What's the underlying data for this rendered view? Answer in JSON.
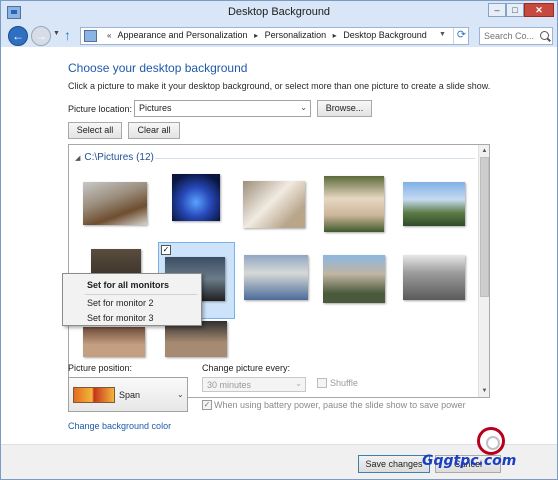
{
  "window": {
    "title": "Desktop Background",
    "min": "–",
    "max": "□",
    "close": "✕"
  },
  "nav": {
    "back": "←",
    "forward": "→",
    "up": "↑",
    "breadcrumbs": [
      "Appearance and Personalization",
      "Personalization",
      "Desktop Background"
    ],
    "search_placeholder": "Search Co..."
  },
  "main": {
    "heading": "Choose your desktop background",
    "instructions": "Click a picture to make it your desktop background, or select more than one picture to create a slide show.",
    "location_label": "Picture location:",
    "location_value": "Pictures",
    "browse_label": "Browse...",
    "select_all_label": "Select all",
    "clear_all_label": "Clear all",
    "group_label": "C:\\Pictures (12)",
    "selected_mark": "✓"
  },
  "context_menu": {
    "items": [
      "Set for all monitors",
      "Set for monitor 2",
      "Set for monitor 3"
    ]
  },
  "options": {
    "position_label": "Picture position:",
    "position_value": "Span",
    "interval_label": "Change picture every:",
    "interval_value": "30 minutes",
    "shuffle_label": "Shuffle",
    "battery_label": "When using battery power, pause the slide show to save power",
    "battery_checked": "✓",
    "change_color_label": "Change background color"
  },
  "footer": {
    "save_label": "Save changes",
    "cancel_label": "Cancel"
  },
  "watermark": {
    "text": "Gqgtpc.com"
  },
  "colors": {
    "accent": "#1e5aa8",
    "selection": "#cce3f9",
    "nav_back": "#2f6fc1",
    "close": "#c74a3e"
  }
}
